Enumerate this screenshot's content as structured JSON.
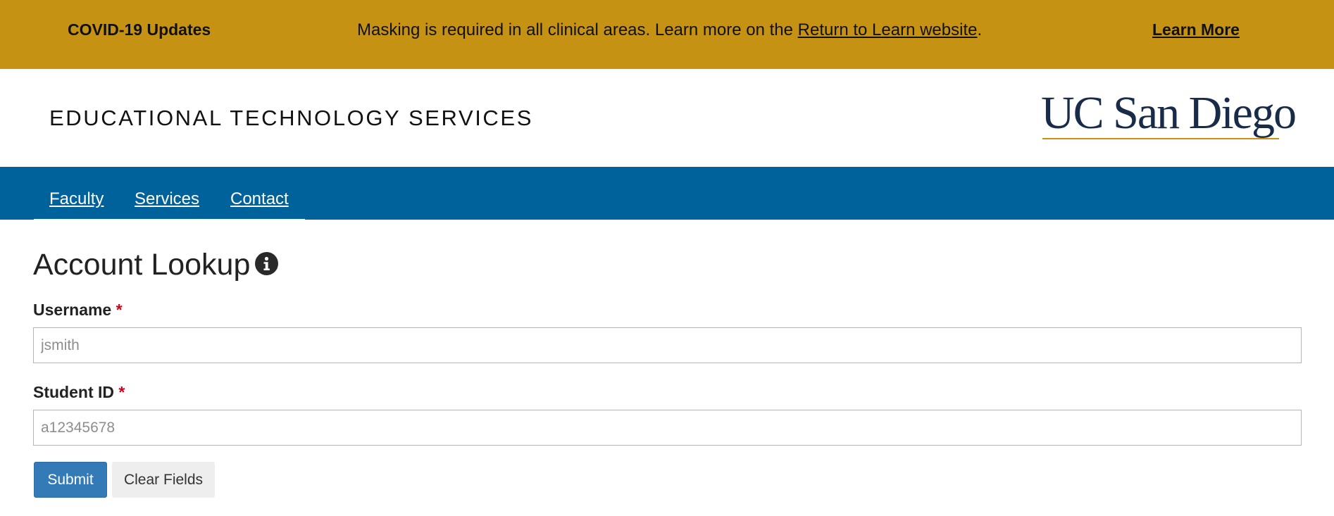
{
  "alert": {
    "title": "COVID-19 Updates",
    "message_before": "Masking is required in all clinical areas. Learn more on the ",
    "message_link": "Return to Learn website",
    "message_after": ".",
    "learn_more": "Learn More"
  },
  "header": {
    "site_title": "EDUCATIONAL TECHNOLOGY SERVICES",
    "logo_text": "UC San Diego"
  },
  "nav": {
    "items": [
      {
        "label": "Faculty"
      },
      {
        "label": "Services"
      },
      {
        "label": "Contact"
      }
    ]
  },
  "form": {
    "title": "Account Lookup",
    "username": {
      "label": "Username",
      "required_mark": "*",
      "placeholder": "jsmith",
      "value": ""
    },
    "student_id": {
      "label": "Student ID",
      "required_mark": "*",
      "placeholder": "a12345678",
      "value": ""
    },
    "submit_label": "Submit",
    "clear_label": "Clear Fields"
  },
  "colors": {
    "alert_bg": "#c69214",
    "nav_bg": "#00629b",
    "brand_navy": "#182b49",
    "submit_bg": "#337ab7",
    "required": "#d0021b"
  },
  "icons": {
    "heading_info": "info-circle-icon"
  }
}
